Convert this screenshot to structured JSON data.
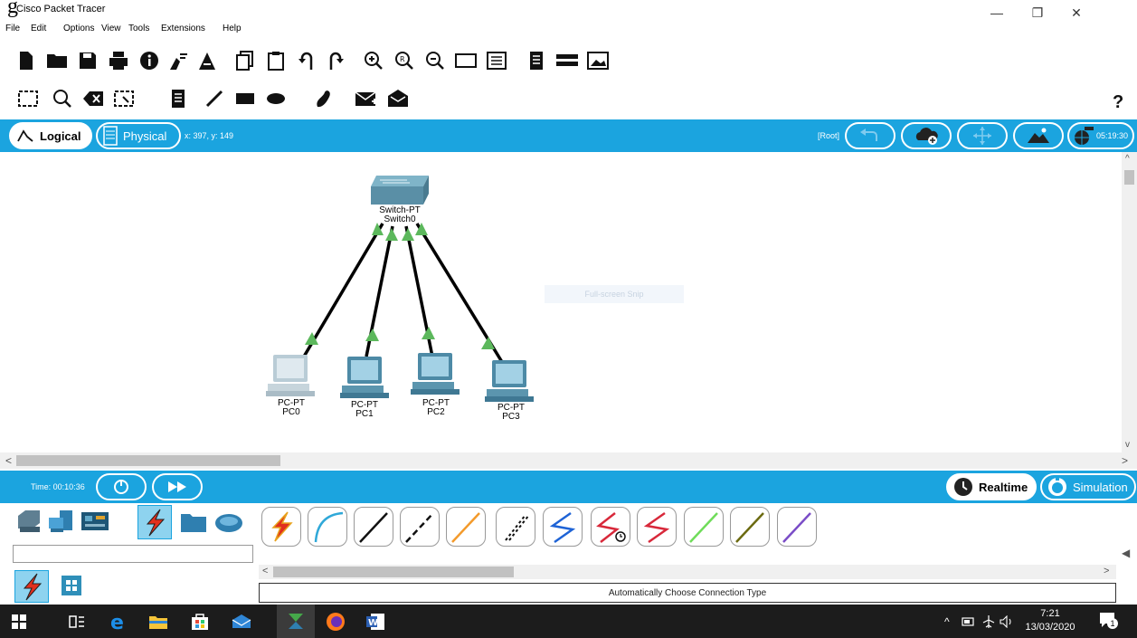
{
  "window": {
    "overlay_title": "g",
    "title": "Cisco Packet Tracer",
    "minimize": "—",
    "maximize": "❐",
    "close": "✕"
  },
  "menu": [
    "File",
    "Edit",
    "Options",
    "View",
    "Tools",
    "Extensions",
    "Help"
  ],
  "toolbar": {
    "help_label": "?"
  },
  "view_bar": {
    "logical_label": "Logical",
    "physical_label": "Physical",
    "coords": "x: 397, y: 149",
    "root_label": "[Root]",
    "clock": "05:19:30"
  },
  "workspace": {
    "snip_label": "Full-screen Snip",
    "switch": {
      "model": "Switch-PT",
      "name": "Switch0"
    },
    "pcs": [
      {
        "model": "PC-PT",
        "name": "PC0"
      },
      {
        "model": "PC-PT",
        "name": "PC1"
      },
      {
        "model": "PC-PT",
        "name": "PC2"
      },
      {
        "model": "PC-PT",
        "name": "PC3"
      }
    ],
    "link_color": "#000000",
    "link_status_color": "#5cb85c"
  },
  "time_bar": {
    "time_text": "Time: 00:10:36",
    "realtime_label": "Realtime",
    "simulation_label": "Simulation"
  },
  "connections_panel": {
    "status_text": "Automatically Choose Connection Type",
    "cables": [
      "automatic-connection",
      "console",
      "copper-straight-through",
      "copper-cross-over",
      "fiber",
      "phone",
      "coaxial",
      "serial-dce",
      "serial-dte",
      "octal",
      "iot-custom",
      "usb"
    ]
  },
  "taskbar": {
    "time": "7:21",
    "date": "13/03/2020",
    "notification_count": "1"
  },
  "colors": {
    "accent": "#1ba4df",
    "taskbar": "#1c1c1c"
  }
}
